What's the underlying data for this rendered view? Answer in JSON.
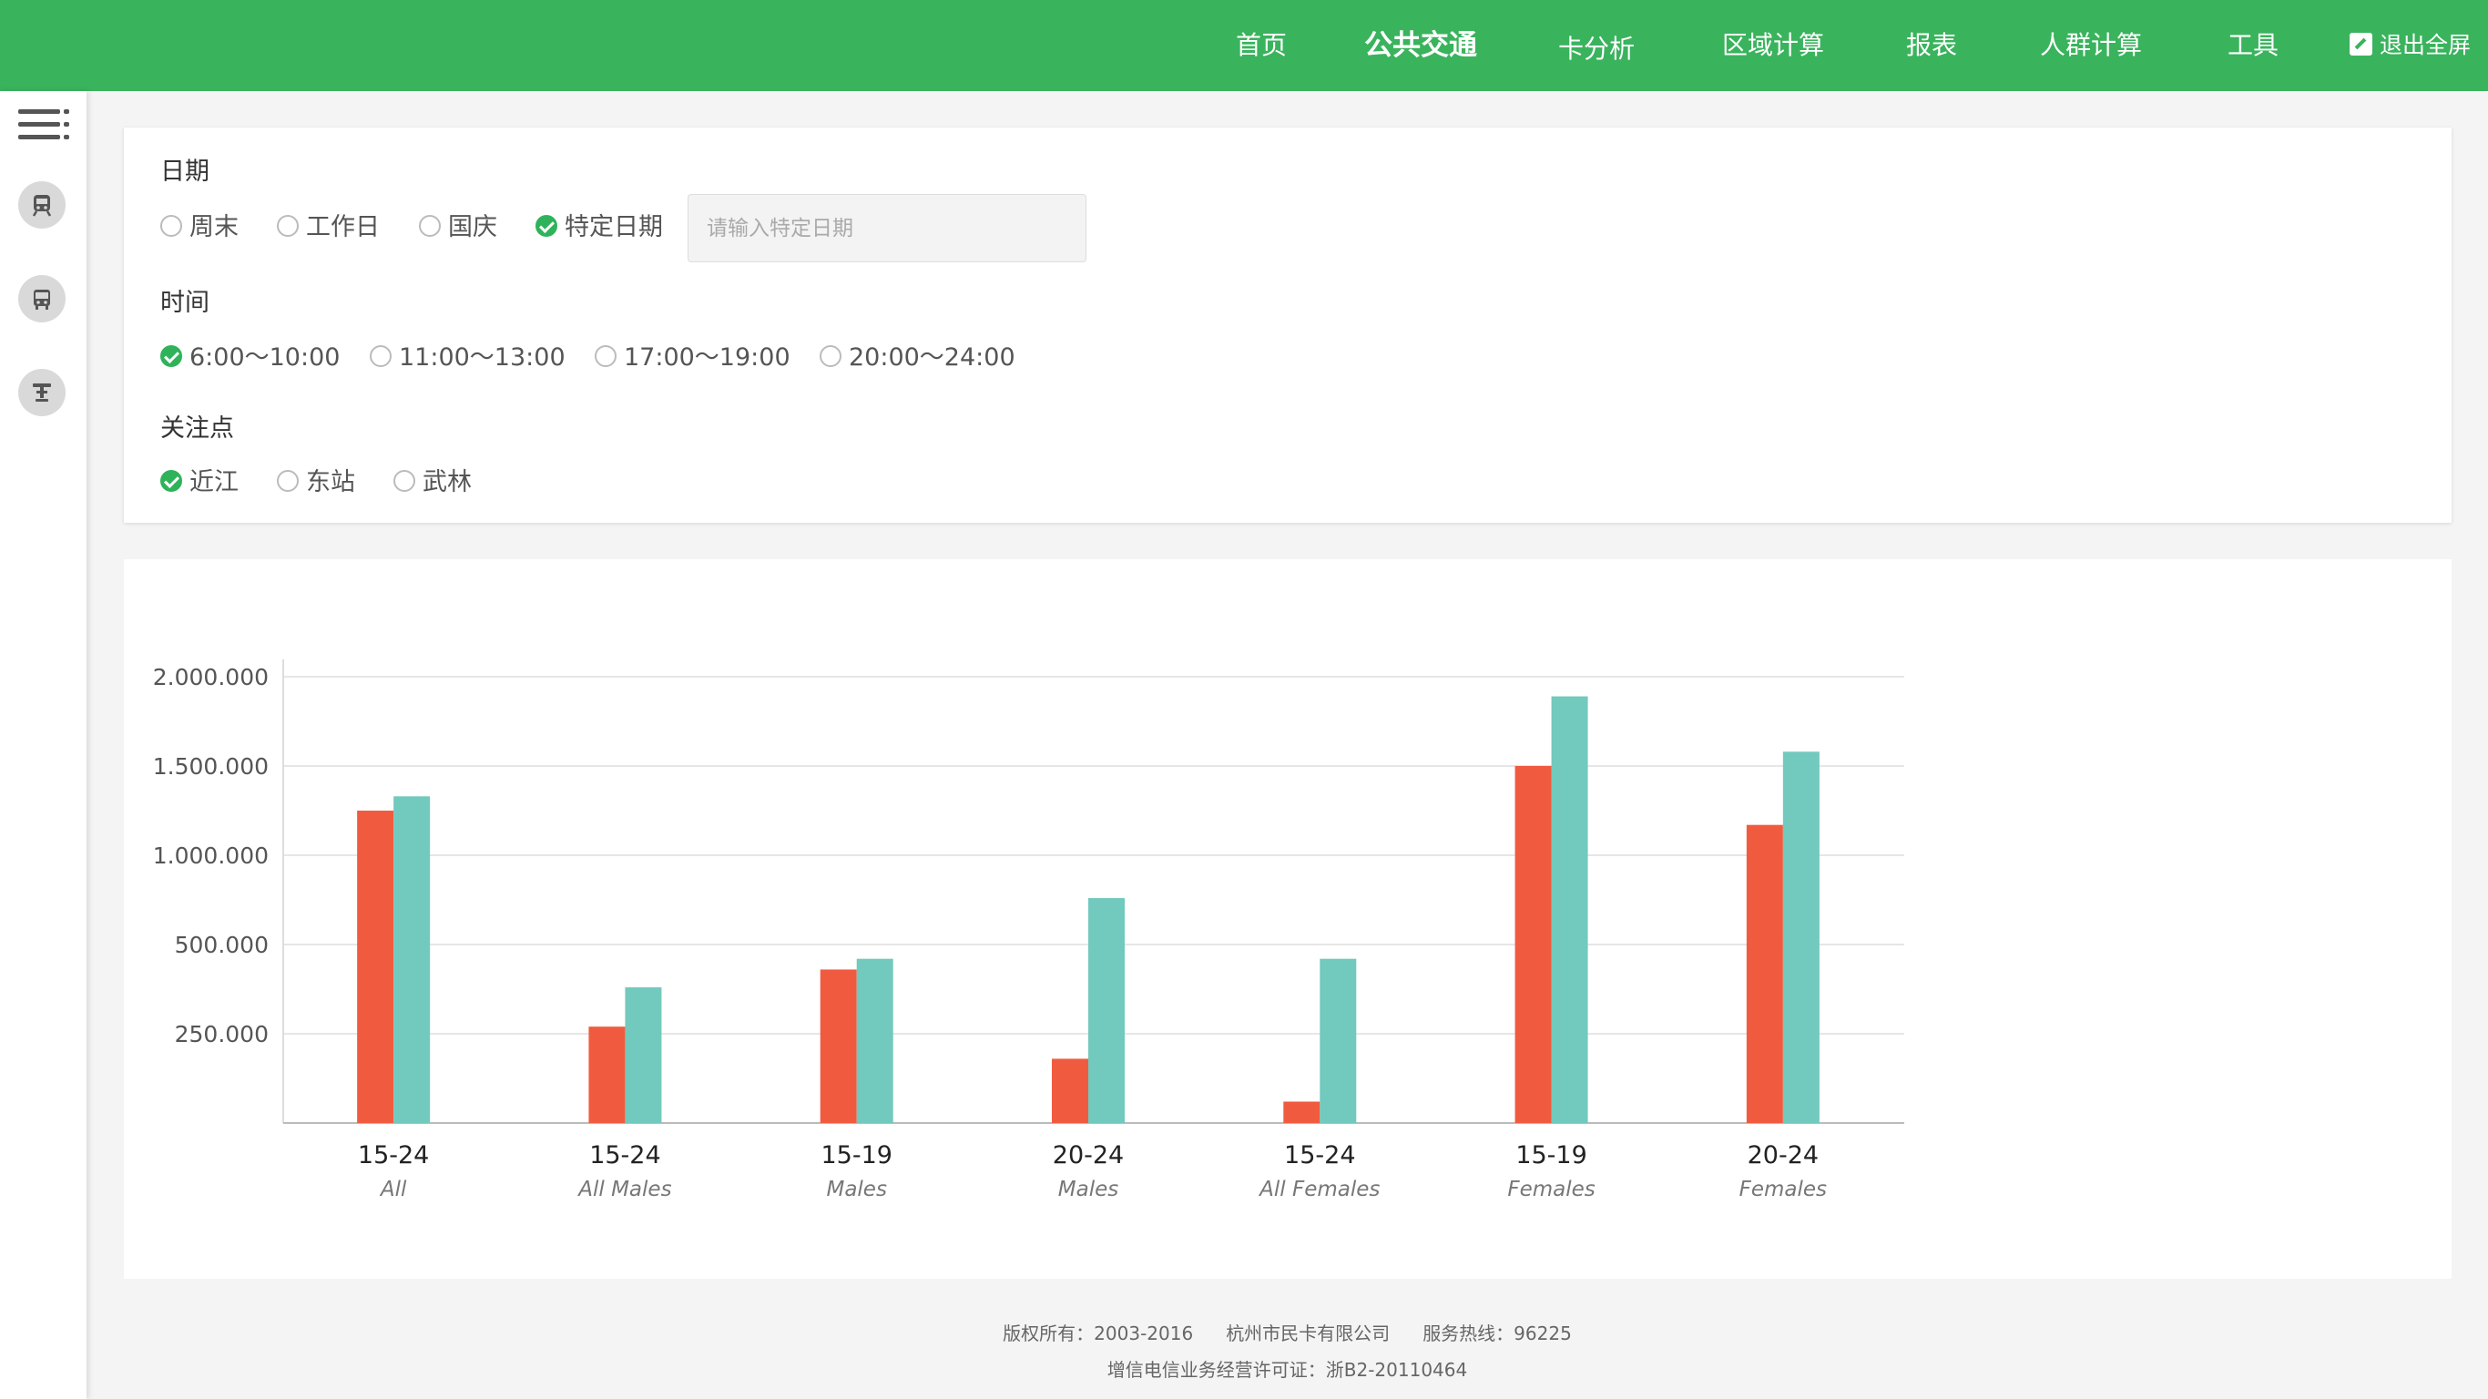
{
  "nav": {
    "items": [
      {
        "label": "首页",
        "active": false
      },
      {
        "label": "公共交通",
        "active": true
      },
      {
        "label": "卡分析",
        "active": false
      },
      {
        "label": "区域计算",
        "active": false
      },
      {
        "label": "报表",
        "active": false
      },
      {
        "label": "人群计算",
        "active": false
      },
      {
        "label": "工具",
        "active": false
      }
    ],
    "fullscreen_label": "退出全屏"
  },
  "sidebar": {
    "icons": [
      "menu-icon",
      "train-icon",
      "bus-icon",
      "bike-icon"
    ]
  },
  "filters": {
    "date": {
      "label": "日期",
      "options": [
        {
          "label": "周末",
          "checked": false
        },
        {
          "label": "工作日",
          "checked": false
        },
        {
          "label": "国庆",
          "checked": false
        },
        {
          "label": "特定日期",
          "checked": true
        }
      ],
      "input_placeholder": "请输入特定日期",
      "input_value": ""
    },
    "time": {
      "label": "时间",
      "options": [
        {
          "label": "6:00～10:00",
          "checked": true
        },
        {
          "label": "11:00～13:00",
          "checked": false
        },
        {
          "label": "17:00～19:00",
          "checked": false
        },
        {
          "label": "20:00～24:00",
          "checked": false
        }
      ]
    },
    "focus": {
      "label": "关注点",
      "options": [
        {
          "label": "近江",
          "checked": true
        },
        {
          "label": "东站",
          "checked": false
        },
        {
          "label": "武林",
          "checked": false
        }
      ]
    }
  },
  "chart_data": {
    "type": "bar",
    "categories": [
      "15-24",
      "15-24",
      "15-19",
      "20-24",
      "15-24",
      "15-19",
      "20-24"
    ],
    "subcategories": [
      "All",
      "All Males",
      "Males",
      "Males",
      "All Females",
      "Females",
      "Females"
    ],
    "series": [
      {
        "color": "#f05b40",
        "values": [
          1250000,
          270000,
          430000,
          180000,
          60000,
          1500000,
          1170000
        ]
      },
      {
        "color": "#72c9bd",
        "values": [
          1330000,
          380000,
          460000,
          760000,
          460000,
          1890000,
          1580000
        ]
      }
    ],
    "y_ticks": [
      {
        "value": 250000,
        "label": "250.000"
      },
      {
        "value": 500000,
        "label": "500.000"
      },
      {
        "value": 1000000,
        "label": "1.000.000"
      },
      {
        "value": 1500000,
        "label": "1.500.000"
      },
      {
        "value": 2000000,
        "label": "2.000.000"
      }
    ],
    "scale_note": "the printed tick labels are unevenly spaced; axis positions run at a uniform 250 per step",
    "grid": true,
    "title": "",
    "xlabel": "",
    "ylabel": ""
  },
  "footer": {
    "copyright": "版权所有：2003-2016",
    "company": "杭州市民卡有限公司",
    "hotline": "服务热线：96225",
    "license": "增信电信业务经营许可证：浙B2-20110464"
  }
}
